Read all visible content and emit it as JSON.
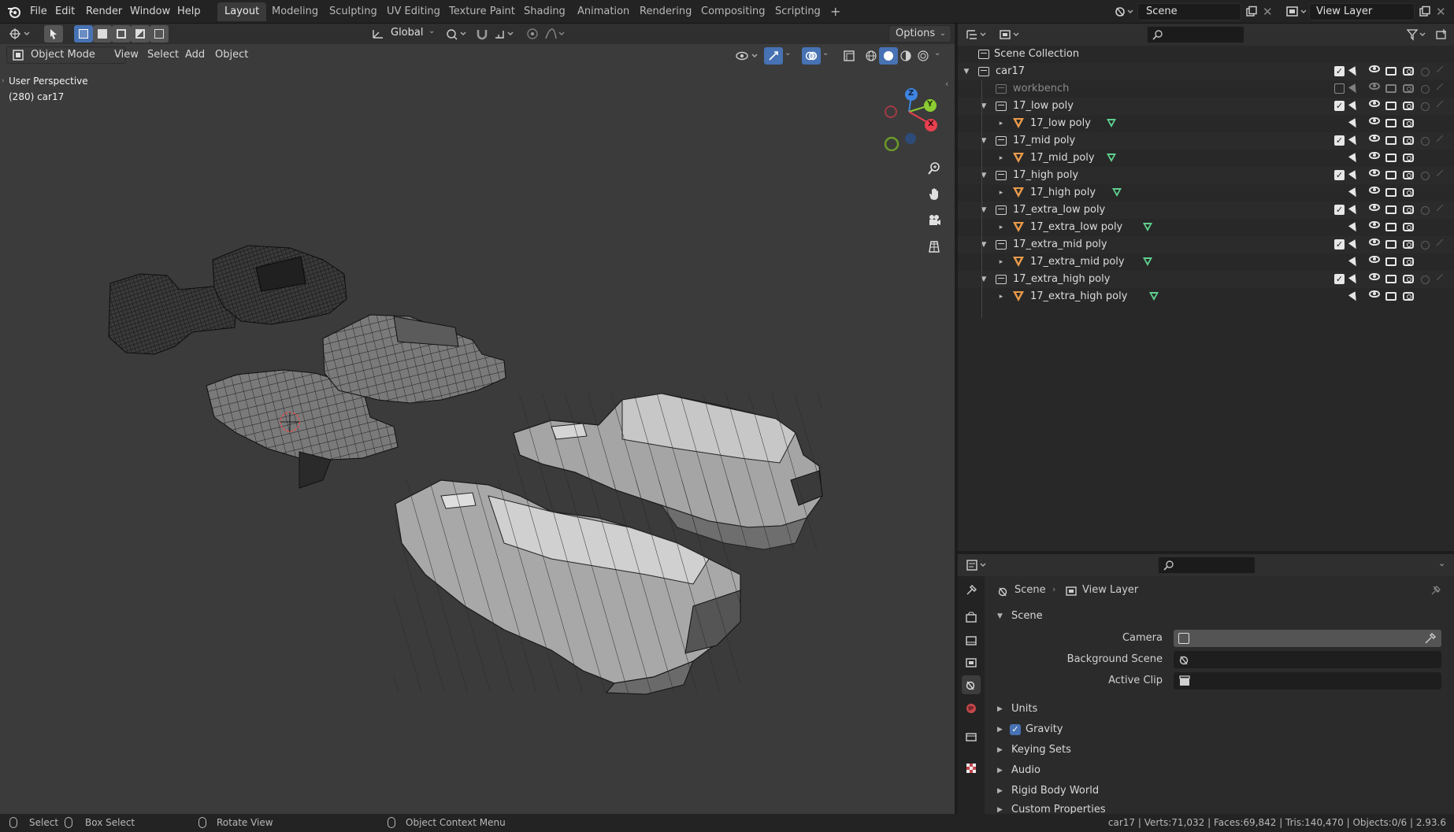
{
  "menubar": {
    "items": [
      "File",
      "Edit",
      "Render",
      "Window",
      "Help"
    ],
    "workspaces": [
      "Layout",
      "Modeling",
      "Sculpting",
      "UV Editing",
      "Texture Paint",
      "Shading",
      "Animation",
      "Rendering",
      "Compositing",
      "Scripting"
    ],
    "active_workspace": "Layout",
    "add_tab": "+",
    "scene_name": "Scene",
    "view_layer_name": "View Layer"
  },
  "viewport": {
    "transform_orientation": "Global",
    "options_label": "Options",
    "mode": "Object Mode",
    "menus": [
      "View",
      "Select",
      "Add",
      "Object"
    ],
    "overlay_title": "User Perspective",
    "overlay_subtitle": "(280) car17",
    "gizmo": {
      "z": "Z",
      "y": "Y",
      "x": "X"
    },
    "colors": {
      "background": "#3b3b3b",
      "x_axis": "#e8404f",
      "y_axis": "#8bcc32",
      "z_axis": "#3e84e0"
    }
  },
  "outliner": {
    "root": "Scene Collection",
    "rows": [
      {
        "label": "car17",
        "type": "collection",
        "depth": 0,
        "expanded": true,
        "checkbox": true
      },
      {
        "label": "workbench",
        "type": "collection",
        "depth": 1,
        "expanded": false,
        "checkbox": false,
        "dimmed": true
      },
      {
        "label": "17_low poly",
        "type": "collection",
        "depth": 1,
        "expanded": true,
        "checkbox": true
      },
      {
        "label": "17_low poly",
        "type": "object",
        "depth": 2
      },
      {
        "label": "17_mid poly",
        "type": "collection",
        "depth": 1,
        "expanded": true,
        "checkbox": true
      },
      {
        "label": "17_mid_poly",
        "type": "object",
        "depth": 2
      },
      {
        "label": "17_high poly",
        "type": "collection",
        "depth": 1,
        "expanded": true,
        "checkbox": true
      },
      {
        "label": "17_high poly",
        "type": "object",
        "depth": 2
      },
      {
        "label": "17_extra_low poly",
        "type": "collection",
        "depth": 1,
        "expanded": true,
        "checkbox": true
      },
      {
        "label": "17_extra_low poly",
        "type": "object",
        "depth": 2
      },
      {
        "label": "17_extra_mid poly",
        "type": "collection",
        "depth": 1,
        "expanded": true,
        "checkbox": true
      },
      {
        "label": "17_extra_mid poly",
        "type": "object",
        "depth": 2
      },
      {
        "label": "17_extra_high poly",
        "type": "collection",
        "depth": 1,
        "expanded": true,
        "checkbox": true
      },
      {
        "label": "17_extra_high poly",
        "type": "object",
        "depth": 2
      }
    ]
  },
  "properties": {
    "breadcrumb": [
      "Scene",
      "View Layer"
    ],
    "panel_title": "Scene",
    "fields": [
      {
        "label": "Camera",
        "value": ""
      },
      {
        "label": "Background Scene",
        "value": ""
      },
      {
        "label": "Active Clip",
        "value": ""
      }
    ],
    "sections": [
      "Units",
      "Gravity",
      "Keying Sets",
      "Audio",
      "Rigid Body World",
      "Custom Properties"
    ],
    "gravity_enabled": true
  },
  "statusbar": {
    "select": "Select",
    "box_select": "Box Select",
    "rotate_view": "Rotate View",
    "context_menu": "Object Context Menu",
    "stats": "car17 | Verts:71,032 | Faces:69,842 | Tris:140,470 | Objects:0/6 | 2.93.6"
  }
}
